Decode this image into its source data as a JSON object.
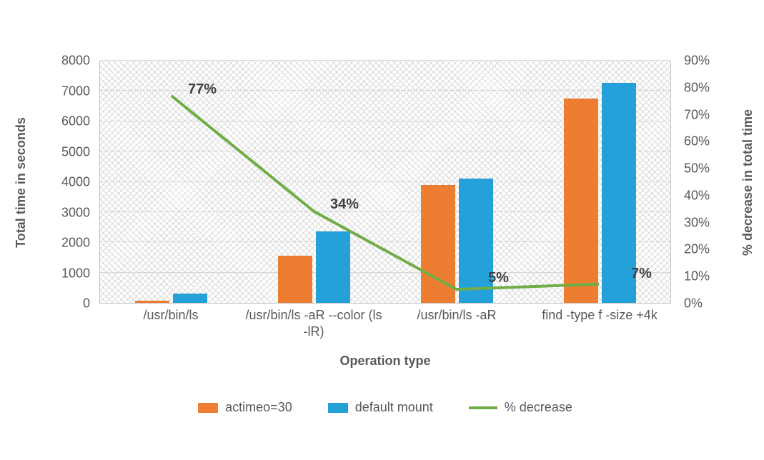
{
  "chart_data": {
    "type": "bar",
    "categories": [
      "/usr/bin/ls",
      "/usr/bin/ls -aR --color (ls -lR)",
      "/usr/bin/ls -aR",
      "find -type f -size +4k"
    ],
    "series": [
      {
        "name": "actimeo=30",
        "values": [
          70,
          1550,
          3900,
          6750
        ],
        "color": "#ed7d31"
      },
      {
        "name": "default mount",
        "values": [
          300,
          2350,
          4100,
          7270
        ],
        "color": "#25a1da"
      }
    ],
    "line_series": {
      "name": "% decrease",
      "values": [
        77,
        34,
        5,
        7
      ],
      "color": "#70ad47"
    },
    "title": "",
    "xlabel": "Operation type",
    "ylabel": "Total time in seconds",
    "ylabel2": "% decrease in total time",
    "ylim": [
      0,
      8000
    ],
    "yticks": [
      0,
      1000,
      2000,
      3000,
      4000,
      5000,
      6000,
      7000,
      8000
    ],
    "y2lim": [
      0,
      90
    ],
    "y2ticks": [
      "0%",
      "10%",
      "20%",
      "30%",
      "40%",
      "50%",
      "60%",
      "70%",
      "80%",
      "90%"
    ],
    "data_labels": [
      "77%",
      "34%",
      "5%",
      "7%"
    ]
  }
}
